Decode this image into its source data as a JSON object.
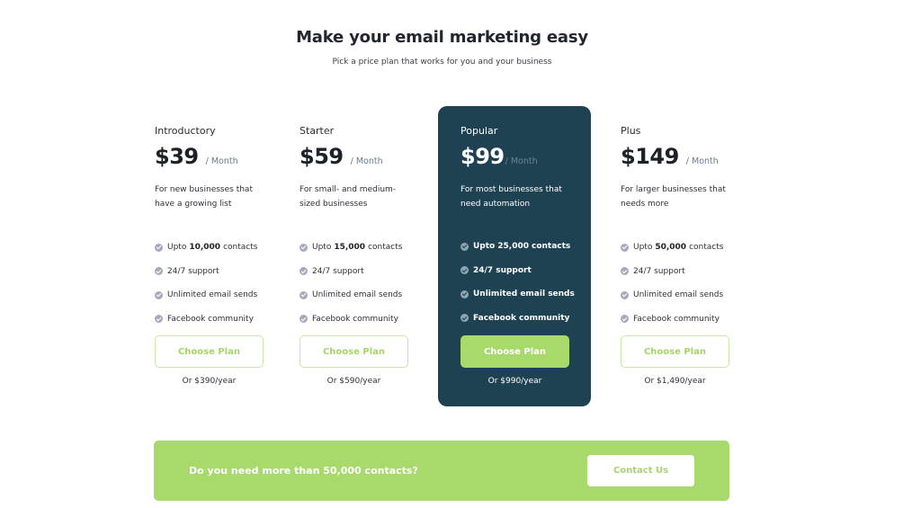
{
  "header": {
    "title": "Make your email marketing easy",
    "subtitle": "Pick a price plan that works for you and your business"
  },
  "plans": [
    {
      "name": "Introductory",
      "price": "$39",
      "period": "/ Month",
      "description": "For new businesses that have a growing list",
      "features": [
        {
          "prefix": "Upto",
          "bold": "10,000",
          "suffix": "contacts",
          "icon": "check-circle-icon"
        },
        {
          "text": "24/7 support",
          "icon": "check-circle-icon"
        },
        {
          "text": "Unlimited email sends",
          "icon": "check-circle-icon"
        },
        {
          "text": "Facebook community",
          "icon": "check-circle-icon"
        }
      ],
      "button_label": "Choose Plan",
      "yearly": "Or $390/year",
      "highlighted": false
    },
    {
      "name": "Starter",
      "price": "$59",
      "period": "/ Month",
      "description": "For small- and medium-sized businesses",
      "features": [
        {
          "prefix": "Upto",
          "bold": "15,000",
          "suffix": "contacts",
          "icon": "check-circle-icon"
        },
        {
          "text": "24/7 support",
          "icon": "check-circle-icon"
        },
        {
          "text": "Unlimited email sends",
          "icon": "check-circle-icon"
        },
        {
          "text": "Facebook community",
          "icon": "check-circle-icon"
        }
      ],
      "button_label": "Choose Plan",
      "yearly": "Or $590/year",
      "highlighted": false
    },
    {
      "name": "Popular",
      "price": "$99",
      "period": "/ Month",
      "description": "For most businesses that need automation",
      "features": [
        {
          "prefix": "Upto",
          "bold": "25,000",
          "suffix": "contacts",
          "icon": "check-circle-icon"
        },
        {
          "text": "24/7 support",
          "icon": "check-circle-icon"
        },
        {
          "text": "Unlimited email sends",
          "icon": "check-circle-icon"
        },
        {
          "text": "Facebook community",
          "icon": "check-circle-icon"
        }
      ],
      "button_label": "Choose Plan",
      "yearly": "Or $990/year",
      "highlighted": true
    },
    {
      "name": "Plus",
      "price": "$149",
      "period": "/ Month",
      "description": "For larger businesses that needs more",
      "features": [
        {
          "prefix": "Upto",
          "bold": "50,000",
          "suffix": "contacts",
          "icon": "check-circle-icon"
        },
        {
          "text": "24/7 support",
          "icon": "check-circle-icon"
        },
        {
          "text": "Unlimited email sends",
          "icon": "check-circle-icon"
        },
        {
          "text": "Facebook community",
          "icon": "check-circle-icon"
        }
      ],
      "button_label": "Choose Plan",
      "yearly": "Or $1,490/year",
      "highlighted": false
    }
  ],
  "cta": {
    "text": "Do you need more than 50,000 contacts?",
    "button_label": "Contact Us"
  },
  "colors": {
    "accent_green": "#a8d96b",
    "popular_bg": "#1f4253",
    "heading": "#23262f",
    "muted": "#6b7a90",
    "check_icon": "#a7a9bd"
  }
}
